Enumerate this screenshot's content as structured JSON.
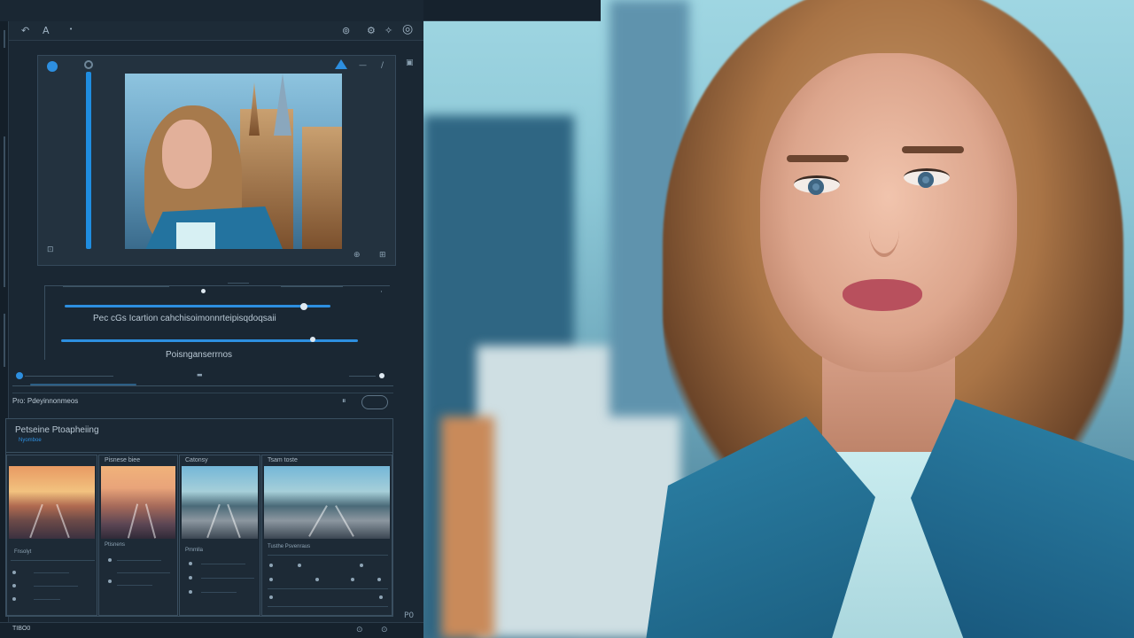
{
  "toolbar": {
    "undo_icon": "undo-icon",
    "text_tool_icon": "triangle-tool-icon",
    "tool_label": "A",
    "right_icons": [
      "camera-icon",
      "gear-icon",
      "circle-icon"
    ]
  },
  "preview": {
    "tool_icons": [
      "record-dot-icon",
      "ring-icon"
    ]
  },
  "adjustments": {
    "label_primary": "Pec cGs Icartion cahchisoimonnrteipisqdoqsaii",
    "label_secondary": "Poisnganserrnos",
    "slider1_level": 0.9,
    "slider2_level": 0.85
  },
  "timeline": {
    "label": "Pro: Pdeyinnonmeos"
  },
  "library": {
    "title": "Petseine Ptoapheiing",
    "subtitle": "Nyomboe",
    "cards": [
      {
        "caption": "",
        "image": "sunset"
      },
      {
        "caption": "Pisnese biee",
        "image": "sunset-cool"
      },
      {
        "caption": "Catonsy",
        "image": "blue-road"
      },
      {
        "caption": "Tsam toste",
        "image": "blue-road"
      }
    ],
    "controls": [
      {
        "heading": "Fnsolyt"
      },
      {
        "heading": "Ptisnens"
      },
      {
        "heading": "Pmmlla"
      },
      {
        "heading": "Tusthe Psvenraus"
      }
    ]
  },
  "statusbar": {
    "left_text": "TIBO0"
  },
  "colors": {
    "accent": "#2d8fe0",
    "panel": "#1a2733",
    "border": "#3a4f60"
  }
}
